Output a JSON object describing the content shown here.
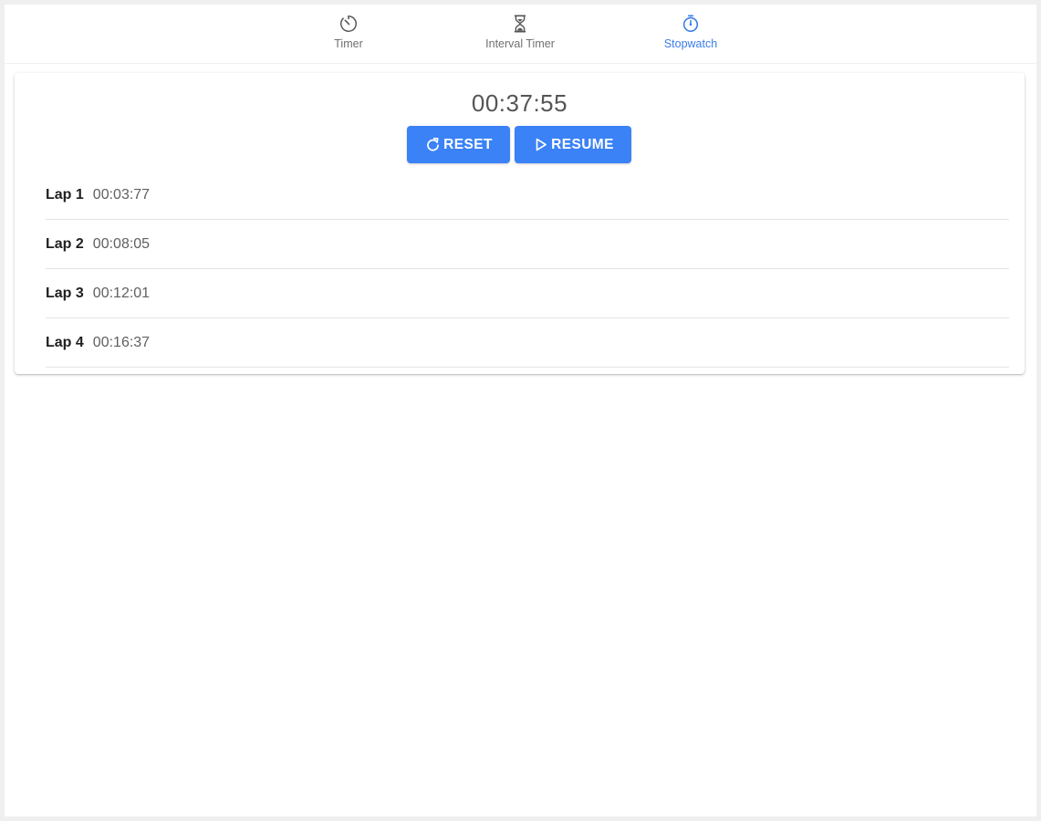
{
  "tabs": [
    {
      "label": "Timer",
      "icon": "timer-icon",
      "active": false
    },
    {
      "label": "Interval Timer",
      "icon": "hourglass-icon",
      "active": false
    },
    {
      "label": "Stopwatch",
      "icon": "stopwatch-icon",
      "active": true
    }
  ],
  "stopwatch": {
    "elapsed": "00:37:55",
    "reset_label": "RESET",
    "resume_label": "RESUME"
  },
  "laps": [
    {
      "name": "Lap 1",
      "time": "00:03:77"
    },
    {
      "name": "Lap 2",
      "time": "00:08:05"
    },
    {
      "name": "Lap 3",
      "time": "00:12:01"
    },
    {
      "name": "Lap 4",
      "time": "00:16:37"
    }
  ],
  "colors": {
    "accent": "#3b82f6",
    "active_tab": "#3a7dea",
    "inactive_tab": "#707070"
  }
}
